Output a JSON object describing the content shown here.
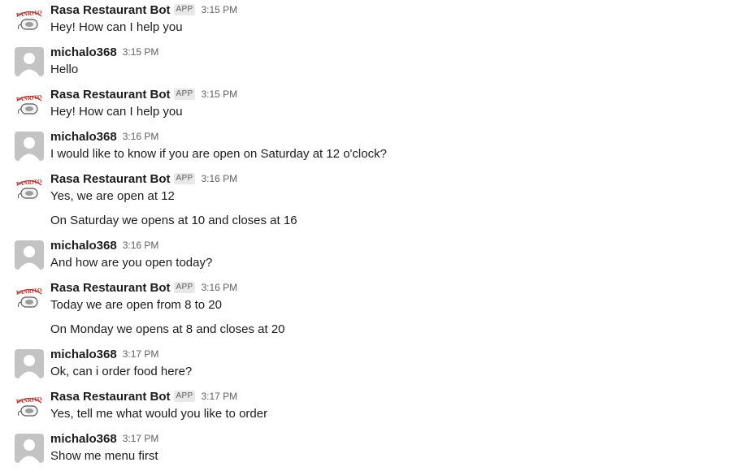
{
  "bot_name": "Rasa Restaurant Bot",
  "app_badge": "APP",
  "user_name": "michalo368",
  "logo_text": "PANRITO",
  "colors": {
    "text": "#1d1c1d",
    "muted": "#616061",
    "avatar_user": "#c3c3c3",
    "logo_red": "#b0302a"
  },
  "messages": [
    {
      "from": "bot",
      "sender": "Rasa Restaurant Bot",
      "badge": "APP",
      "time": "3:15 PM",
      "lines": [
        "Hey! How can I help you"
      ]
    },
    {
      "from": "user",
      "sender": "michalo368",
      "time": "3:15 PM",
      "lines": [
        "Hello"
      ]
    },
    {
      "from": "bot",
      "sender": "Rasa Restaurant Bot",
      "badge": "APP",
      "time": "3:15 PM",
      "lines": [
        "Hey! How can I help you"
      ]
    },
    {
      "from": "user",
      "sender": "michalo368",
      "time": "3:16 PM",
      "lines": [
        "I would like to know if you are open on Saturday at 12 o'clock?"
      ]
    },
    {
      "from": "bot",
      "sender": "Rasa Restaurant Bot",
      "badge": "APP",
      "time": "3:16 PM",
      "lines": [
        "Yes, we are open at 12",
        "On Saturday we opens at 10 and closes at 16"
      ]
    },
    {
      "from": "user",
      "sender": "michalo368",
      "time": "3:16 PM",
      "lines": [
        "And how are you open today?"
      ]
    },
    {
      "from": "bot",
      "sender": "Rasa Restaurant Bot",
      "badge": "APP",
      "time": "3:16 PM",
      "lines": [
        "Today we are open from 8 to 20",
        "On Monday we opens at 8 and closes at 20"
      ]
    },
    {
      "from": "user",
      "sender": "michalo368",
      "time": "3:17 PM",
      "lines": [
        "Ok, can i order food here?"
      ]
    },
    {
      "from": "bot",
      "sender": "Rasa Restaurant Bot",
      "badge": "APP",
      "time": "3:17 PM",
      "lines": [
        "Yes, tell me what would you like to order"
      ]
    },
    {
      "from": "user",
      "sender": "michalo368",
      "time": "3:17 PM",
      "lines": [
        "Show me menu first"
      ]
    }
  ]
}
